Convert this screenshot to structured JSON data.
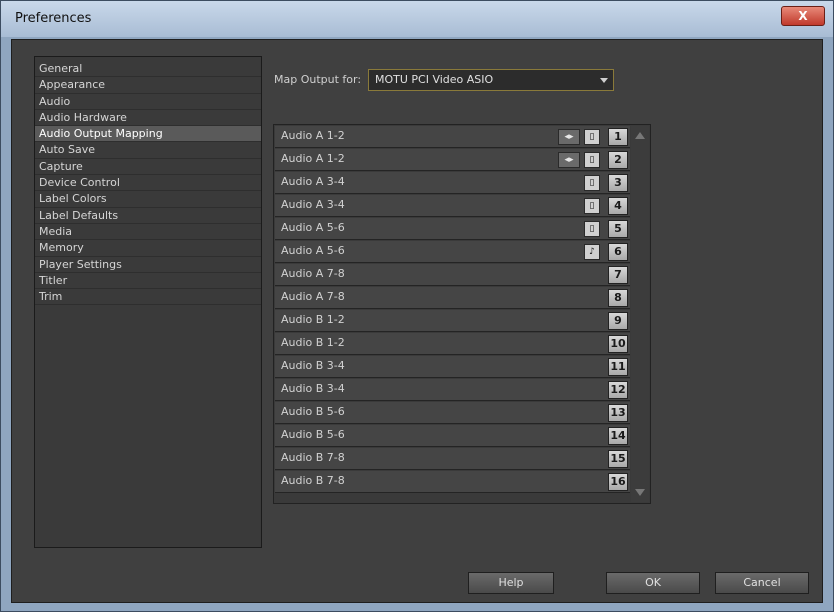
{
  "window": {
    "title": "Preferences",
    "close_label": "X"
  },
  "sidebar": {
    "items": [
      {
        "label": "General"
      },
      {
        "label": "Appearance"
      },
      {
        "label": "Audio"
      },
      {
        "label": "Audio Hardware"
      },
      {
        "label": "Audio Output Mapping",
        "selected": true
      },
      {
        "label": "Auto Save"
      },
      {
        "label": "Capture"
      },
      {
        "label": "Device Control"
      },
      {
        "label": "Label Colors"
      },
      {
        "label": "Label Defaults"
      },
      {
        "label": "Media"
      },
      {
        "label": "Memory"
      },
      {
        "label": "Player Settings"
      },
      {
        "label": "Titler"
      },
      {
        "label": "Trim"
      }
    ]
  },
  "map_output": {
    "label": "Map Output for:",
    "selected": "MOTU PCI Video ASIO"
  },
  "mapping": {
    "rows": [
      {
        "label": "Audio A 1-2",
        "channel": "1"
      },
      {
        "label": "Audio A 1-2",
        "channel": "2"
      },
      {
        "label": "Audio A 3-4",
        "channel": "3"
      },
      {
        "label": "Audio A 3-4",
        "channel": "4"
      },
      {
        "label": "Audio A 5-6",
        "channel": "5"
      },
      {
        "label": "Audio A 5-6",
        "channel": "6"
      },
      {
        "label": "Audio A 7-8",
        "channel": "7"
      },
      {
        "label": "Audio A 7-8",
        "channel": "8"
      },
      {
        "label": "Audio B 1-2",
        "channel": "9"
      },
      {
        "label": "Audio B 1-2",
        "channel": "10"
      },
      {
        "label": "Audio B 3-4",
        "channel": "11"
      },
      {
        "label": "Audio B 3-4",
        "channel": "12"
      },
      {
        "label": "Audio B 5-6",
        "channel": "13"
      },
      {
        "label": "Audio B 5-6",
        "channel": "14"
      },
      {
        "label": "Audio B 7-8",
        "channel": "15"
      },
      {
        "label": "Audio B 7-8",
        "channel": "16"
      }
    ]
  },
  "buttons": {
    "help": "Help",
    "ok": "OK",
    "cancel": "Cancel"
  },
  "icons": {
    "stereo": "stereo-icon",
    "mono": "mono-icon",
    "speaker": "speaker-icon"
  }
}
